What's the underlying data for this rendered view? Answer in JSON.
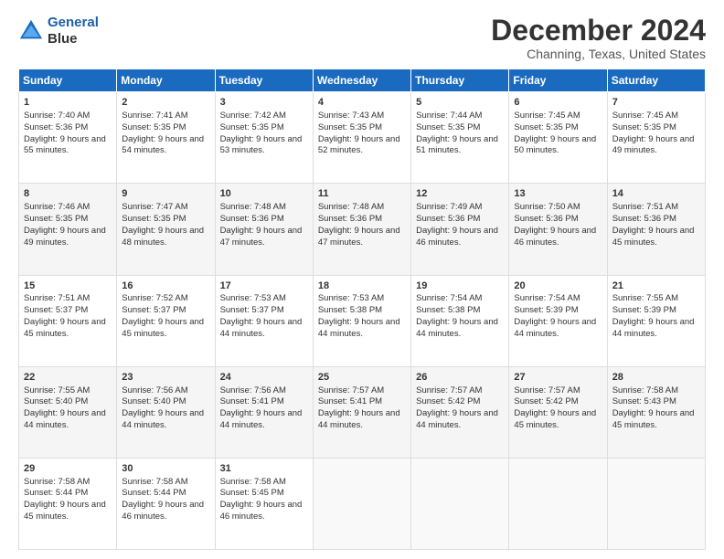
{
  "logo": {
    "line1": "General",
    "line2": "Blue"
  },
  "title": "December 2024",
  "subtitle": "Channing, Texas, United States",
  "headers": [
    "Sunday",
    "Monday",
    "Tuesday",
    "Wednesday",
    "Thursday",
    "Friday",
    "Saturday"
  ],
  "weeks": [
    [
      {
        "day": "1",
        "sunrise": "7:40 AM",
        "sunset": "5:36 PM",
        "daylight": "9 hours and 55 minutes."
      },
      {
        "day": "2",
        "sunrise": "7:41 AM",
        "sunset": "5:35 PM",
        "daylight": "9 hours and 54 minutes."
      },
      {
        "day": "3",
        "sunrise": "7:42 AM",
        "sunset": "5:35 PM",
        "daylight": "9 hours and 53 minutes."
      },
      {
        "day": "4",
        "sunrise": "7:43 AM",
        "sunset": "5:35 PM",
        "daylight": "9 hours and 52 minutes."
      },
      {
        "day": "5",
        "sunrise": "7:44 AM",
        "sunset": "5:35 PM",
        "daylight": "9 hours and 51 minutes."
      },
      {
        "day": "6",
        "sunrise": "7:45 AM",
        "sunset": "5:35 PM",
        "daylight": "9 hours and 50 minutes."
      },
      {
        "day": "7",
        "sunrise": "7:45 AM",
        "sunset": "5:35 PM",
        "daylight": "9 hours and 49 minutes."
      }
    ],
    [
      {
        "day": "8",
        "sunrise": "7:46 AM",
        "sunset": "5:35 PM",
        "daylight": "9 hours and 49 minutes."
      },
      {
        "day": "9",
        "sunrise": "7:47 AM",
        "sunset": "5:35 PM",
        "daylight": "9 hours and 48 minutes."
      },
      {
        "day": "10",
        "sunrise": "7:48 AM",
        "sunset": "5:36 PM",
        "daylight": "9 hours and 47 minutes."
      },
      {
        "day": "11",
        "sunrise": "7:48 AM",
        "sunset": "5:36 PM",
        "daylight": "9 hours and 47 minutes."
      },
      {
        "day": "12",
        "sunrise": "7:49 AM",
        "sunset": "5:36 PM",
        "daylight": "9 hours and 46 minutes."
      },
      {
        "day": "13",
        "sunrise": "7:50 AM",
        "sunset": "5:36 PM",
        "daylight": "9 hours and 46 minutes."
      },
      {
        "day": "14",
        "sunrise": "7:51 AM",
        "sunset": "5:36 PM",
        "daylight": "9 hours and 45 minutes."
      }
    ],
    [
      {
        "day": "15",
        "sunrise": "7:51 AM",
        "sunset": "5:37 PM",
        "daylight": "9 hours and 45 minutes."
      },
      {
        "day": "16",
        "sunrise": "7:52 AM",
        "sunset": "5:37 PM",
        "daylight": "9 hours and 45 minutes."
      },
      {
        "day": "17",
        "sunrise": "7:53 AM",
        "sunset": "5:37 PM",
        "daylight": "9 hours and 44 minutes."
      },
      {
        "day": "18",
        "sunrise": "7:53 AM",
        "sunset": "5:38 PM",
        "daylight": "9 hours and 44 minutes."
      },
      {
        "day": "19",
        "sunrise": "7:54 AM",
        "sunset": "5:38 PM",
        "daylight": "9 hours and 44 minutes."
      },
      {
        "day": "20",
        "sunrise": "7:54 AM",
        "sunset": "5:39 PM",
        "daylight": "9 hours and 44 minutes."
      },
      {
        "day": "21",
        "sunrise": "7:55 AM",
        "sunset": "5:39 PM",
        "daylight": "9 hours and 44 minutes."
      }
    ],
    [
      {
        "day": "22",
        "sunrise": "7:55 AM",
        "sunset": "5:40 PM",
        "daylight": "9 hours and 44 minutes."
      },
      {
        "day": "23",
        "sunrise": "7:56 AM",
        "sunset": "5:40 PM",
        "daylight": "9 hours and 44 minutes."
      },
      {
        "day": "24",
        "sunrise": "7:56 AM",
        "sunset": "5:41 PM",
        "daylight": "9 hours and 44 minutes."
      },
      {
        "day": "25",
        "sunrise": "7:57 AM",
        "sunset": "5:41 PM",
        "daylight": "9 hours and 44 minutes."
      },
      {
        "day": "26",
        "sunrise": "7:57 AM",
        "sunset": "5:42 PM",
        "daylight": "9 hours and 44 minutes."
      },
      {
        "day": "27",
        "sunrise": "7:57 AM",
        "sunset": "5:42 PM",
        "daylight": "9 hours and 45 minutes."
      },
      {
        "day": "28",
        "sunrise": "7:58 AM",
        "sunset": "5:43 PM",
        "daylight": "9 hours and 45 minutes."
      }
    ],
    [
      {
        "day": "29",
        "sunrise": "7:58 AM",
        "sunset": "5:44 PM",
        "daylight": "9 hours and 45 minutes."
      },
      {
        "day": "30",
        "sunrise": "7:58 AM",
        "sunset": "5:44 PM",
        "daylight": "9 hours and 46 minutes."
      },
      {
        "day": "31",
        "sunrise": "7:58 AM",
        "sunset": "5:45 PM",
        "daylight": "9 hours and 46 minutes."
      },
      null,
      null,
      null,
      null
    ]
  ]
}
